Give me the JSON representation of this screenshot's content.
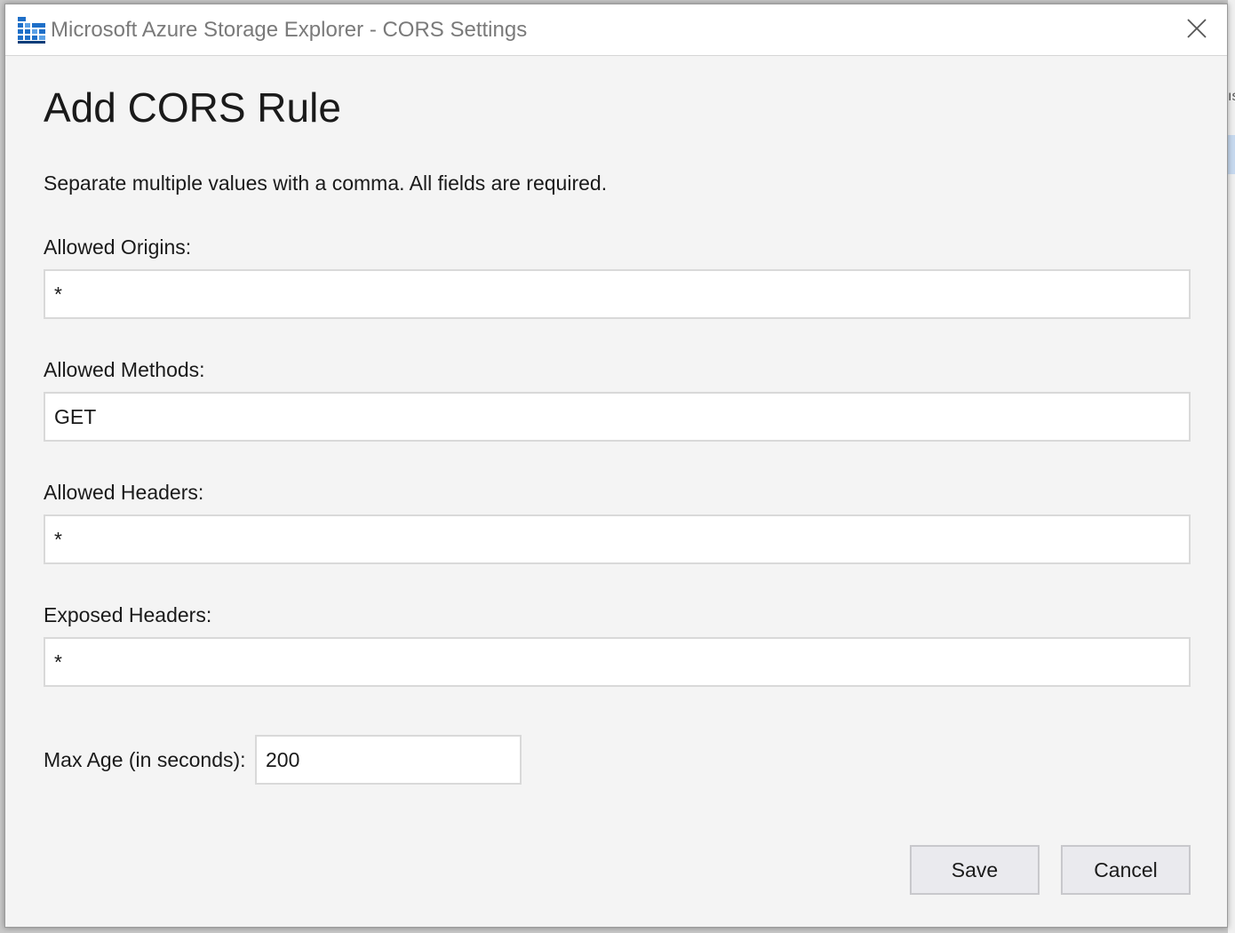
{
  "window": {
    "title": "Microsoft Azure Storage Explorer - CORS Settings",
    "app_icon": "storage-explorer-icon",
    "close_icon": "close-icon"
  },
  "dialog": {
    "heading": "Add CORS Rule",
    "instructions": "Separate multiple values with a comma. All fields are required."
  },
  "fields": {
    "allowed_origins": {
      "label": "Allowed Origins:",
      "value": "*"
    },
    "allowed_methods": {
      "label": "Allowed Methods:",
      "value": "GET"
    },
    "allowed_headers": {
      "label": "Allowed Headers:",
      "value": "*"
    },
    "exposed_headers": {
      "label": "Exposed Headers:",
      "value": "*"
    },
    "max_age": {
      "label": "Max Age (in seconds):",
      "value": "200"
    }
  },
  "buttons": {
    "save": "Save",
    "cancel": "Cancel"
  },
  "background": {
    "partial_text": "ıs"
  },
  "colors": {
    "dialog_background": "#f4f4f4",
    "icon_blue": "#1e6fc8",
    "button_background": "#eaeaee"
  }
}
